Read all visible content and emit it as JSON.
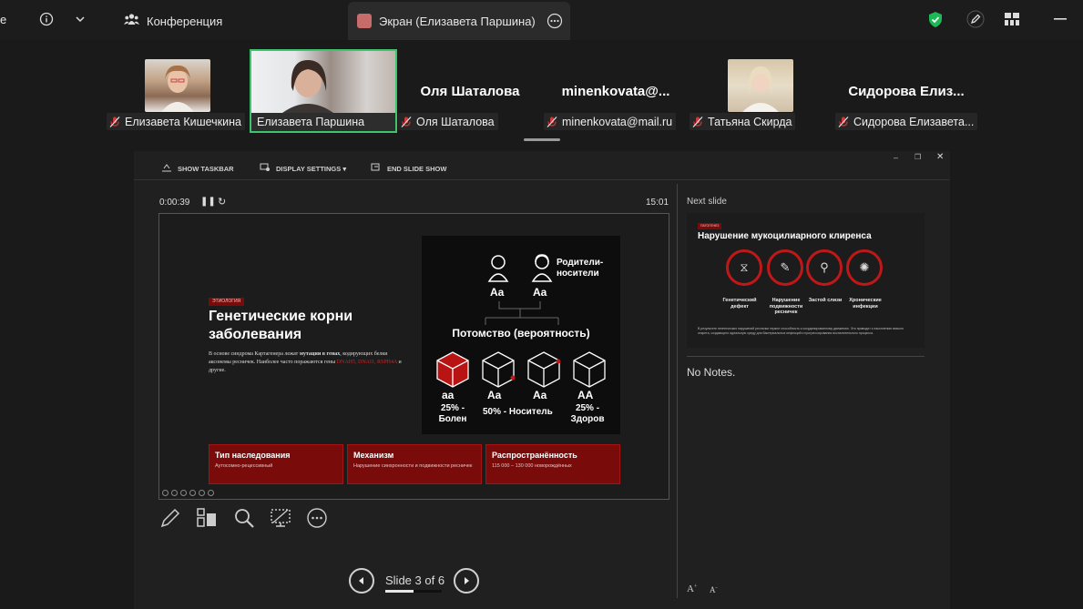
{
  "topbar": {
    "edge_text": "e",
    "tab_conference": "Конференция",
    "tab_screen": "Экран (Елизавета Паршина)"
  },
  "participants": [
    {
      "name": "Елизавета Кишечкина",
      "display": "",
      "has_video": true
    },
    {
      "name": "Елизавета Паршина",
      "display": "",
      "has_video": true,
      "active": true
    },
    {
      "name": "Оля Шаталова",
      "display": "Оля Шаталова",
      "has_video": false
    },
    {
      "name": "minenkovata@mail.ru",
      "display": "minenkovata@...",
      "has_video": false
    },
    {
      "name": "Татьяна Скирда",
      "display": "",
      "has_video": true
    },
    {
      "name": "Сидорова Елизавета...",
      "display": "Сидорова  Елиз...",
      "has_video": false
    }
  ],
  "presenter": {
    "toolbar": {
      "show_taskbar": "SHOW TASKBAR",
      "display_settings": "DISPLAY SETTINGS ▾",
      "end_slide_show": "END SLIDE SHOW"
    },
    "timer": "0:00:39",
    "clock": "15:01",
    "next_slide_label": "Next slide",
    "notes": "No Notes.",
    "slide_counter": "Slide 3 of 6"
  },
  "slide": {
    "tag": "ЭТИОЛОГИЯ",
    "title_line1": "Генетические корни",
    "title_line2": "заболевания",
    "body1": "В основе синдрома Картагенера лежат ",
    "body_bold": "мутации в генах",
    "body2": ", кодирующих белки аксонемы ресничек. Наиболее часто поражаются гены ",
    "body_red": "DNAH5, DNAI1, RSPH4A",
    "body3": " и другие.",
    "parents_label_1": "Родители-",
    "parents_label_2": "носители",
    "parent_genotype": "Aa",
    "offspring_title": "Потомство (вероятность)",
    "offspring": [
      {
        "genotype": "aa",
        "line1": "25% -",
        "line2": "Болен"
      },
      {
        "genotype": "Aa",
        "line1": "50% - Носитель",
        "line2": ""
      },
      {
        "genotype": "Aa",
        "line1": "",
        "line2": ""
      },
      {
        "genotype": "AA",
        "line1": "25% -",
        "line2": "Здоров"
      }
    ],
    "cards": [
      {
        "title": "Тип наследования",
        "desc": "Аутосомно-рецессивный"
      },
      {
        "title": "Механизм",
        "desc": "Нарушение синхронности и подвижности ресничек"
      },
      {
        "title": "Распространённость",
        "desc": "115 000 – 130 000 новорождённых"
      }
    ]
  },
  "next_slide": {
    "tag": "ПАТОГЕНЕЗ",
    "title": "Нарушение мукоцилиарного клиренса",
    "labels": [
      "Генетический дефект",
      "Нарушение подвижности ресничек",
      "Застой слизи",
      "Хронические инфекции"
    ],
    "text": "В результате генетических нарушений реснички теряют способность к координированному движению. Это приводит к накоплению вязкого секрета, создающего идеальную среду для бактериальных инфекций и прогрессирования воспалительного процесса."
  },
  "colors": {
    "accent_red": "#c01818",
    "active_border": "#3ec46d",
    "shield_green": "#1db954"
  }
}
